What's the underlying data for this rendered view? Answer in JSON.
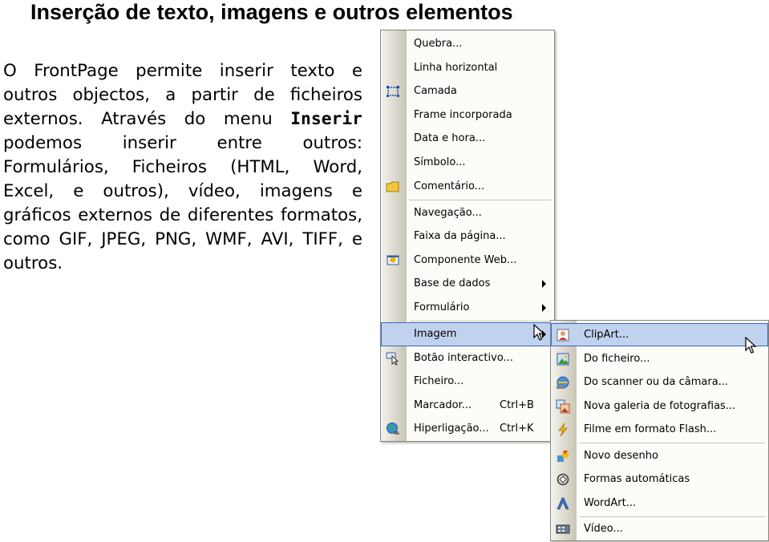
{
  "title": "Inserção de texto, imagens e outros elementos",
  "paragraph": {
    "part1": "O FrontPage permite inserir texto e outros objectos, a partir de ficheiros externos. Através do menu ",
    "bold": "Inserir",
    "part2": " podemos inserir entre outros: Formulários, Ficheiros (HTML, Word, Excel, e outros), vídeo, imagens e gráficos externos de diferentes formatos, como GIF, JPEG, PNG, WMF, AVI, TIFF, e outros."
  },
  "insert_menu": {
    "items": [
      {
        "label": "Quebra..."
      },
      {
        "label": "Linha horizontal"
      },
      {
        "label": "Camada",
        "icon": "layer-icon"
      },
      {
        "label": "Frame incorporada"
      },
      {
        "label": "Data e hora..."
      },
      {
        "label": "Símbolo..."
      },
      {
        "label": "Comentário...",
        "icon": "comment-folder-icon"
      },
      {
        "label": "Navegação..."
      },
      {
        "label": "Faixa da página..."
      },
      {
        "label": "Componente Web...",
        "icon": "web-component-icon"
      },
      {
        "label": "Base de dados",
        "submenu": true
      },
      {
        "label": "Formulário",
        "submenu": true
      },
      {
        "label": "Imagem",
        "submenu": true,
        "highlighted": true
      },
      {
        "label": "Botão interactivo...",
        "icon": "interactive-button-icon"
      },
      {
        "label": "Ficheiro..."
      },
      {
        "label": "Marcador...",
        "shortcut": "Ctrl+B"
      },
      {
        "label": "Hiperligação...",
        "shortcut": "Ctrl+K",
        "icon": "hyperlink-globe-icon"
      }
    ]
  },
  "image_submenu": {
    "items": [
      {
        "label": "ClipArt...",
        "icon": "clipart-icon",
        "highlighted": true
      },
      {
        "label": "Do ficheiro...",
        "icon": "picture-file-icon"
      },
      {
        "label": "Do scanner ou da câmara...",
        "icon": "scanner-camera-icon"
      },
      {
        "label": "Nova galeria de fotografias...",
        "icon": "photo-gallery-icon"
      },
      {
        "label": "Filme em formato Flash...",
        "icon": "flash-movie-icon"
      },
      {
        "label": "Novo desenho",
        "icon": "new-drawing-icon"
      },
      {
        "label": "Formas automáticas",
        "icon": "autoshapes-icon"
      },
      {
        "label": "WordArt...",
        "icon": "wordart-icon"
      },
      {
        "label": "Vídeo...",
        "icon": "video-icon"
      }
    ]
  },
  "colors": {
    "highlight": "#c1d2ee",
    "highlight_border": "#316ac5",
    "menu_background": "#fcfcf9"
  }
}
